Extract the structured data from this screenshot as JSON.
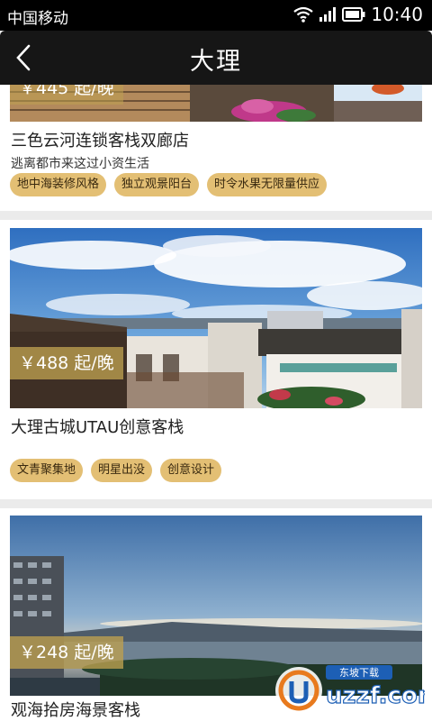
{
  "status_bar": {
    "carrier": "中国移动",
    "time": "10:40"
  },
  "header": {
    "title": "大理",
    "back_icon": "chevron-left-icon"
  },
  "hotels": [
    {
      "price": "￥445 起/晚",
      "name": "三色云河连锁客栈双廊店",
      "description": "逃离都市来这过小资生活",
      "tags": [
        "地中海装修风格",
        "独立观景阳台",
        "时令水果无限量供应"
      ]
    },
    {
      "price": "￥488 起/晚",
      "name": "大理古城UTAU创意客栈",
      "description": "",
      "tags": [
        "文青聚集地",
        "明星出没",
        "创意设计"
      ]
    },
    {
      "price": "￥248 起/晚",
      "name": "观海拾房海景客栈",
      "description": "",
      "tags": []
    }
  ],
  "watermark": {
    "brand": "uzzf.com",
    "caption": "东坡下载"
  },
  "colors": {
    "tag_bg": "#e3bf74",
    "price_overlay": "#bea050",
    "title_bar": "#161616"
  }
}
